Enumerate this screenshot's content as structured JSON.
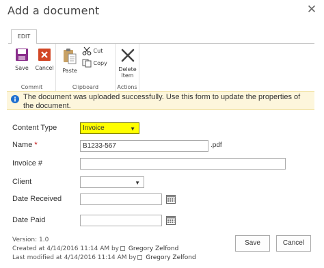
{
  "dialog": {
    "title": "Add a document",
    "close_glyph": "✕"
  },
  "ribbon": {
    "tab": "EDIT",
    "groups": {
      "commit": {
        "label": "Commit",
        "save": "Save",
        "cancel": "Cancel"
      },
      "clipboard": {
        "label": "Clipboard",
        "paste": "Paste",
        "cut": "Cut",
        "copy": "Copy"
      },
      "actions": {
        "label": "Actions",
        "delete_line1": "Delete",
        "delete_line2": "Item"
      }
    }
  },
  "message": "The document was uploaded successfully. Use this form to update the properties of the document.",
  "form": {
    "content_type": {
      "label": "Content Type",
      "value": "Invoice"
    },
    "name": {
      "label": "Name",
      "required_mark": "*",
      "value": "B1233-567",
      "suffix": ".pdf"
    },
    "invoice_number": {
      "label": "Invoice #",
      "value": ""
    },
    "client": {
      "label": "Client",
      "value": ""
    },
    "date_received": {
      "label": "Date Received",
      "value": ""
    },
    "date_paid": {
      "label": "Date Paid",
      "value": ""
    }
  },
  "meta": {
    "version": "Version: 1.0",
    "created_prefix": "Created at 4/14/2016 11:14 AM  by",
    "created_by": "Gregory Zelfond",
    "modified_prefix": "Last modified at 4/14/2016 11:14 AM  by",
    "modified_by": "Gregory Zelfond"
  },
  "buttons": {
    "save": "Save",
    "cancel": "Cancel"
  },
  "colors": {
    "highlight": "#ffff00",
    "message_bg": "#fdf6dc",
    "info": "#1e6fd0",
    "save_icon": "#8a2f8c",
    "cancel_icon": "#d24726"
  },
  "icons": [
    "close-icon",
    "save-icon",
    "cancel-icon",
    "paste-icon",
    "cut-icon",
    "copy-icon",
    "delete-icon",
    "info-icon",
    "calendar-icon",
    "user-presence-icon"
  ]
}
